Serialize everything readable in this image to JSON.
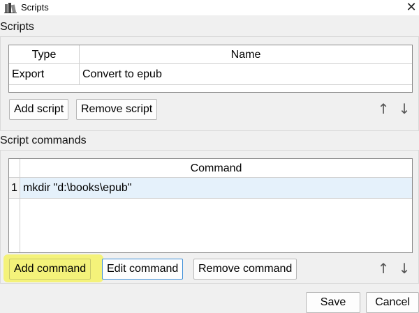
{
  "window": {
    "title": "Scripts",
    "icon": "books-icon",
    "close_symbol": "✕"
  },
  "scripts_section": {
    "title": "Scripts",
    "table": {
      "columns": [
        "Type",
        "Name"
      ],
      "rows": [
        {
          "type": "Export",
          "name": "Convert to epub"
        }
      ]
    },
    "add_label": "Add script",
    "remove_label": "Remove script",
    "up_symbol": "↑",
    "down_symbol": "↓"
  },
  "commands_section": {
    "title": "Script commands",
    "table": {
      "column": "Command",
      "rows": [
        {
          "index": "1",
          "command": "mkdir \"d:\\books\\epub\""
        }
      ]
    },
    "add_label": "Add command",
    "edit_label": "Edit command",
    "remove_label": "Remove command",
    "up_symbol": "↑",
    "down_symbol": "↓"
  },
  "footer": {
    "save_label": "Save",
    "cancel_label": "Cancel"
  },
  "colors": {
    "highlight": "#f4f27a",
    "selected_row": "#e5f1fb",
    "focus_border": "#3c8ed8"
  }
}
